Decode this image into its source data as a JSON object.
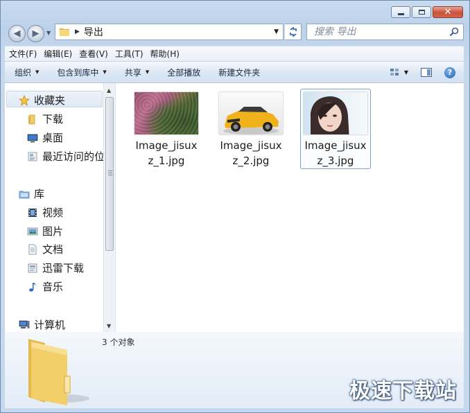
{
  "window": {
    "buttons": {
      "minimize": "minimize-icon",
      "maximize": "maximize-icon",
      "close": "close-icon"
    }
  },
  "address_bar": {
    "path": "导出",
    "search_placeholder": "搜索 导出"
  },
  "menu": [
    "文件(F)",
    "编辑(E)",
    "查看(V)",
    "工具(T)",
    "帮助(H)"
  ],
  "toolbar": {
    "organize": "组织",
    "include_in_library": "包含到库中",
    "share": "共享",
    "play_all": "全部播放",
    "new_folder": "新建文件夹"
  },
  "nav": {
    "favorites": {
      "label": "收藏夹",
      "items": [
        {
          "label": "下载",
          "icon": "download-folder-icon"
        },
        {
          "label": "桌面",
          "icon": "desktop-icon"
        },
        {
          "label": "最近访问的位",
          "icon": "recent-places-icon"
        }
      ]
    },
    "libraries": {
      "label": "库",
      "items": [
        {
          "label": "视频",
          "icon": "video-icon"
        },
        {
          "label": "图片",
          "icon": "pictures-icon"
        },
        {
          "label": "文档",
          "icon": "documents-icon"
        },
        {
          "label": "迅雷下载",
          "icon": "thunder-download-icon"
        },
        {
          "label": "音乐",
          "icon": "music-icon"
        }
      ]
    },
    "computer": {
      "label": "计算机"
    }
  },
  "files": [
    {
      "name": "Image_jisuxz_1.jpg",
      "thumb": "pink-green-flower-thumbnail",
      "selected": false
    },
    {
      "name": "Image_jisuxz_2.jpg",
      "thumb": "yellow-suv-thumbnail",
      "selected": false
    },
    {
      "name": "Image_jisuxz_3.jpg",
      "thumb": "portrait-thumbnail",
      "selected": true
    }
  ],
  "details": {
    "count": "3 个对象"
  },
  "watermark": "极速下载站",
  "colors": {
    "accent": "#3a6fb3",
    "selection_border": "#7da2ce",
    "folder_yellow": "#f2cf69"
  }
}
